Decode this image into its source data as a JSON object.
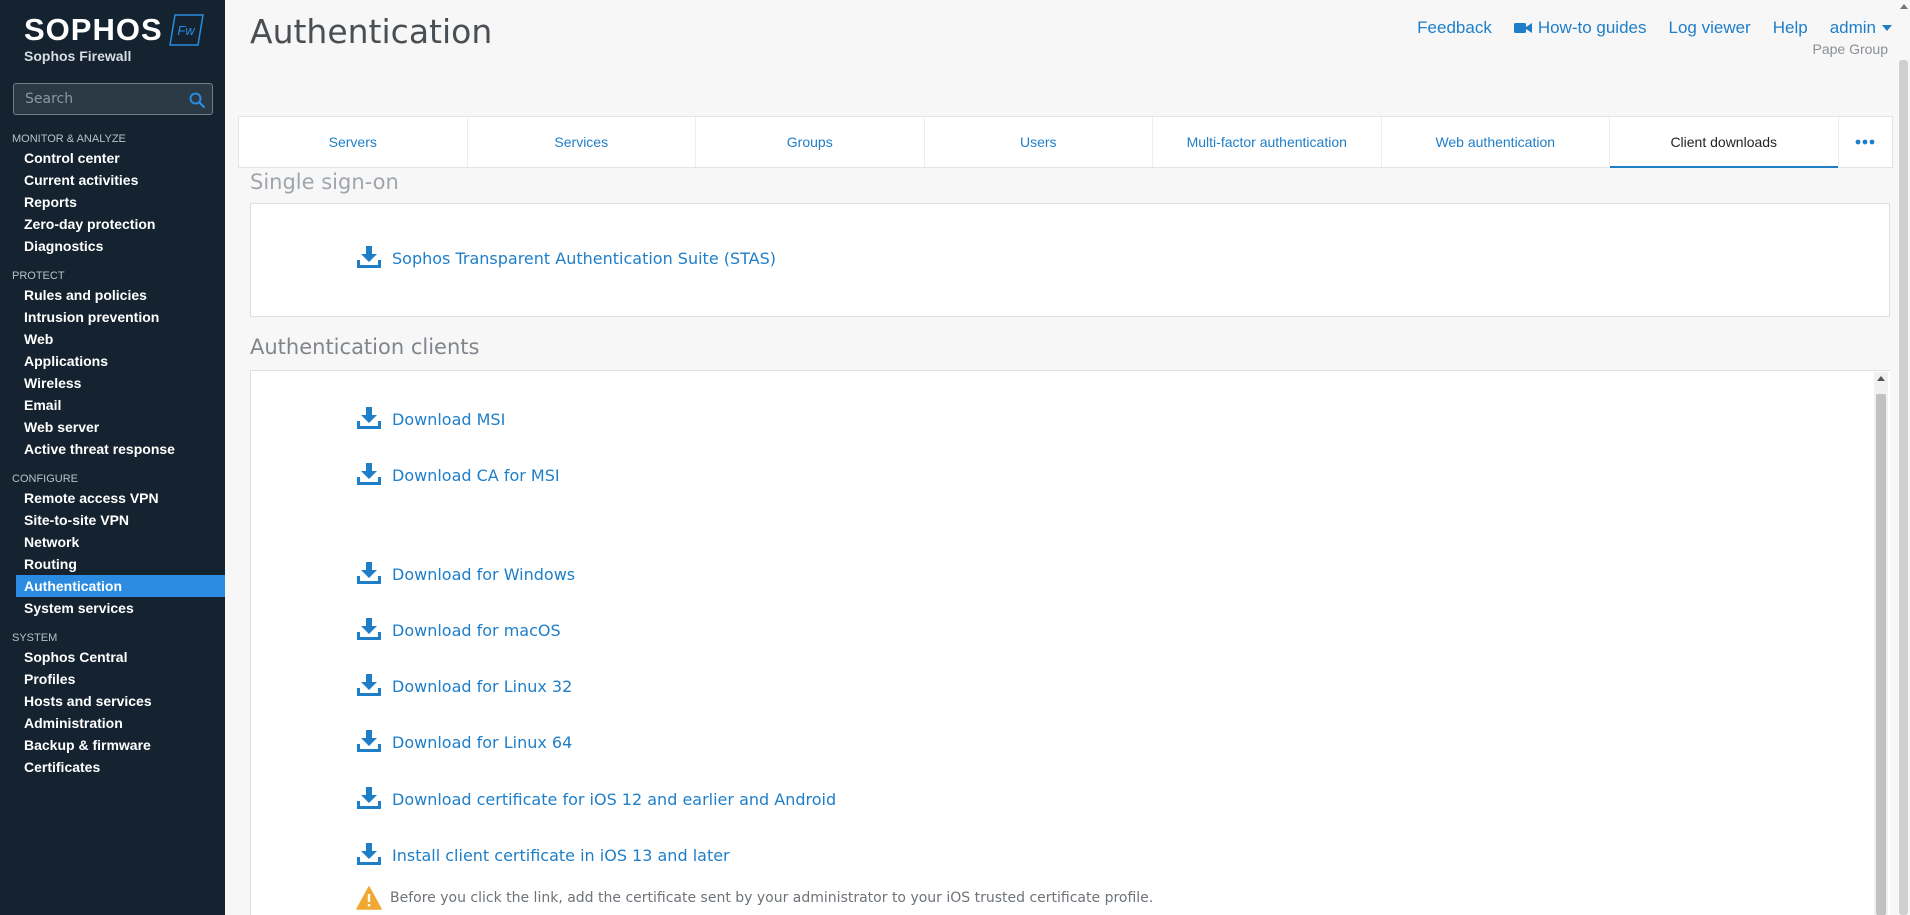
{
  "brand": {
    "name": "SOPHOS",
    "product": "Sophos Firewall",
    "badge": "Fw"
  },
  "search": {
    "placeholder": "Search"
  },
  "nav": {
    "sections": [
      {
        "heading": "MONITOR & ANALYZE",
        "items": [
          "Control center",
          "Current activities",
          "Reports",
          "Zero-day protection",
          "Diagnostics"
        ]
      },
      {
        "heading": "PROTECT",
        "items": [
          "Rules and policies",
          "Intrusion prevention",
          "Web",
          "Applications",
          "Wireless",
          "Email",
          "Web server",
          "Active threat response"
        ]
      },
      {
        "heading": "CONFIGURE",
        "items": [
          "Remote access VPN",
          "Site-to-site VPN",
          "Network",
          "Routing",
          "Authentication",
          "System services"
        ]
      },
      {
        "heading": "SYSTEM",
        "items": [
          "Sophos Central",
          "Profiles",
          "Hosts and services",
          "Administration",
          "Backup & firmware",
          "Certificates"
        ]
      }
    ],
    "active": "Authentication"
  },
  "header": {
    "title": "Authentication",
    "links": {
      "feedback": "Feedback",
      "howto": "How-to guides",
      "logviewer": "Log viewer",
      "help": "Help",
      "admin": "admin"
    },
    "org": "Pape Group"
  },
  "tabs": {
    "items": [
      "Servers",
      "Services",
      "Groups",
      "Users",
      "Multi-factor authentication",
      "Web authentication",
      "Client downloads"
    ],
    "active": "Client downloads"
  },
  "sso": {
    "title": "Single sign-on",
    "items": [
      "Sophos Transparent Authentication Suite (STAS)"
    ]
  },
  "clients": {
    "title": "Authentication clients",
    "items": [
      "Download MSI",
      "Download CA for MSI",
      "Download for Windows",
      "Download for macOS",
      "Download for Linux 32",
      "Download for Linux 64",
      "Download certificate for iOS 12 and earlier and Android",
      "Install client certificate in iOS 13 and later"
    ],
    "warning": "Before you click the link, add the certificate sent by your administrator to your iOS trusted certificate profile."
  },
  "colors": {
    "sidebar": "#14232f",
    "accent": "#1f7ec8",
    "active_nav": "#2a8be0",
    "warning": "#f0a830"
  }
}
